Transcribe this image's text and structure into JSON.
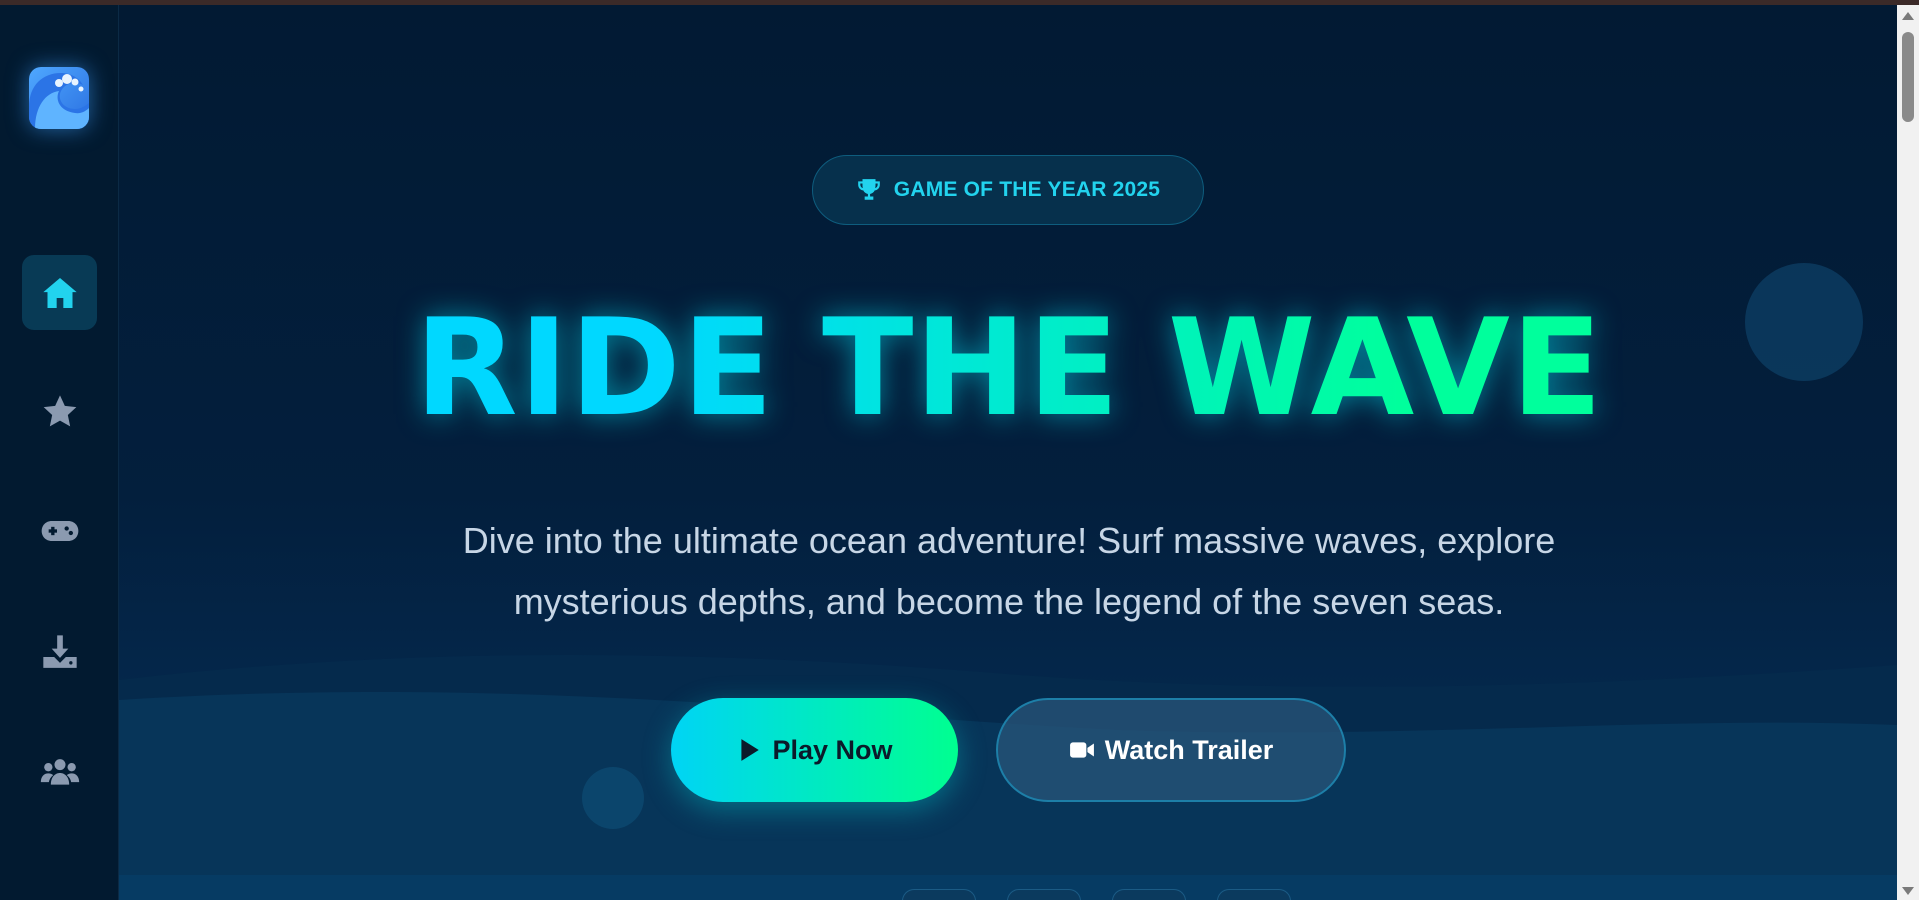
{
  "badge": {
    "icon": "trophy-icon",
    "text": "GAME OF THE YEAR 2025"
  },
  "hero": {
    "title": "RIDE THE WAVE",
    "description": "Dive into the ultimate ocean adventure! Surf massive waves, explore mysterious depths, and become the legend of the seven seas."
  },
  "buttons": {
    "play": {
      "icon": "play-icon",
      "label": "Play Now"
    },
    "trailer": {
      "icon": "video-camera-icon",
      "label": "Watch Trailer"
    }
  },
  "sidebar": {
    "logo": "wave-logo-icon",
    "items": [
      {
        "icon": "home-icon",
        "active": true
      },
      {
        "icon": "star-icon",
        "active": false
      },
      {
        "icon": "gamepad-icon",
        "active": false
      },
      {
        "icon": "download-icon",
        "active": false
      },
      {
        "icon": "users-icon",
        "active": false
      }
    ]
  },
  "colors": {
    "background": "#021a33",
    "accent_cyan": "#00d8ff",
    "accent_green": "#00ff9c",
    "icon_inactive": "#8b9ab0",
    "icon_active": "#22d3ee"
  }
}
